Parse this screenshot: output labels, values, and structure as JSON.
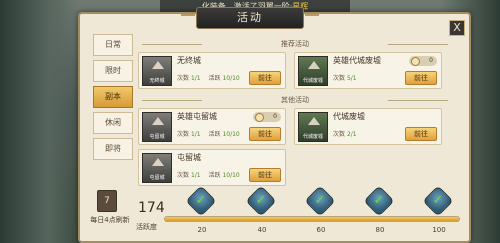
{
  "ticker": {
    "text_a": "化装备，激活了羽翼一阶·",
    "text_b": "星辉"
  },
  "window": {
    "title": "活动",
    "close_label": "X"
  },
  "sidebar": {
    "tabs": [
      {
        "label": "日常",
        "active": false
      },
      {
        "label": "限时",
        "active": false
      },
      {
        "label": "副本",
        "active": true
      },
      {
        "label": "休闲",
        "active": false
      },
      {
        "label": "即将",
        "active": false
      }
    ],
    "refresh_icon": "7",
    "refresh_text": "每日4点刷新"
  },
  "sections": {
    "recommended": "推荐活动",
    "other": "其他活动"
  },
  "cards": [
    {
      "name": "无终城",
      "thumb_label": "无终城",
      "count_label": "次数",
      "count": "1/1",
      "activity_label": "活跃",
      "activity": "10/10",
      "button": "前往",
      "timer": null
    },
    {
      "name": "英雄代城废墟",
      "thumb_label": "代城废墟",
      "count_label": "次数",
      "count": "5/1",
      "activity_label": "",
      "activity": "",
      "button": "前往",
      "timer": "0"
    },
    {
      "name": "英雄屯留城",
      "thumb_label": "屯留城",
      "count_label": "次数",
      "count": "1/1",
      "activity_label": "活跃",
      "activity": "10/10",
      "button": "前往",
      "timer": "0"
    },
    {
      "name": "代城废墟",
      "thumb_label": "代城废墟",
      "count_label": "次数",
      "count": "2/1",
      "activity_label": "",
      "activity": "",
      "button": "前往",
      "timer": null
    },
    {
      "name": "屯留城",
      "thumb_label": "屯留城",
      "count_label": "次数",
      "count": "1/1",
      "activity_label": "活跃",
      "activity": "10/10",
      "button": "前往",
      "timer": null
    }
  ],
  "activity": {
    "value": "174",
    "label": "活跃度",
    "progress_fraction": 1.0,
    "milestones": [
      "20",
      "40",
      "60",
      "80",
      "100"
    ]
  },
  "colors": {
    "accent_gold": "#e0a03d",
    "check_green": "#5ee03a"
  }
}
